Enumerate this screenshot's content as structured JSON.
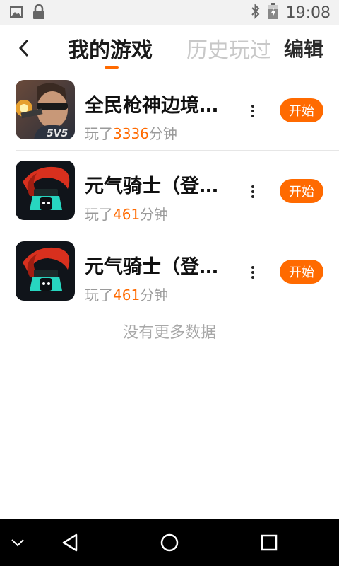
{
  "status_bar": {
    "time": "19:08",
    "left_icons": [
      "image-icon",
      "lock-icon"
    ],
    "right_icons": [
      "bluetooth-icon",
      "battery-charging-icon"
    ]
  },
  "header": {
    "tabs": [
      {
        "label": "我的游戏",
        "active": true
      },
      {
        "label": "历史玩过",
        "active": false
      }
    ],
    "edit_label": "编辑",
    "accent_color": "#ff6a00"
  },
  "games": [
    {
      "title": "全民枪神边境王者",
      "played_prefix": "玩了",
      "minutes": "3336",
      "played_suffix": "分钟",
      "start_label": "开始",
      "icon": "shooter-game-icon"
    },
    {
      "title": "元气骑士（登录版）",
      "played_prefix": "玩了",
      "minutes": "461",
      "played_suffix": "分钟",
      "start_label": "开始",
      "icon": "soul-knight-icon"
    },
    {
      "title": "元气骑士（登录版）",
      "played_prefix": "玩了",
      "minutes": "461",
      "played_suffix": "分钟",
      "start_label": "开始",
      "icon": "soul-knight-icon"
    }
  ],
  "footer_text": "没有更多数据",
  "nav_bar": {
    "buttons": [
      "collapse-icon",
      "back-icon",
      "home-icon",
      "recents-icon"
    ]
  }
}
